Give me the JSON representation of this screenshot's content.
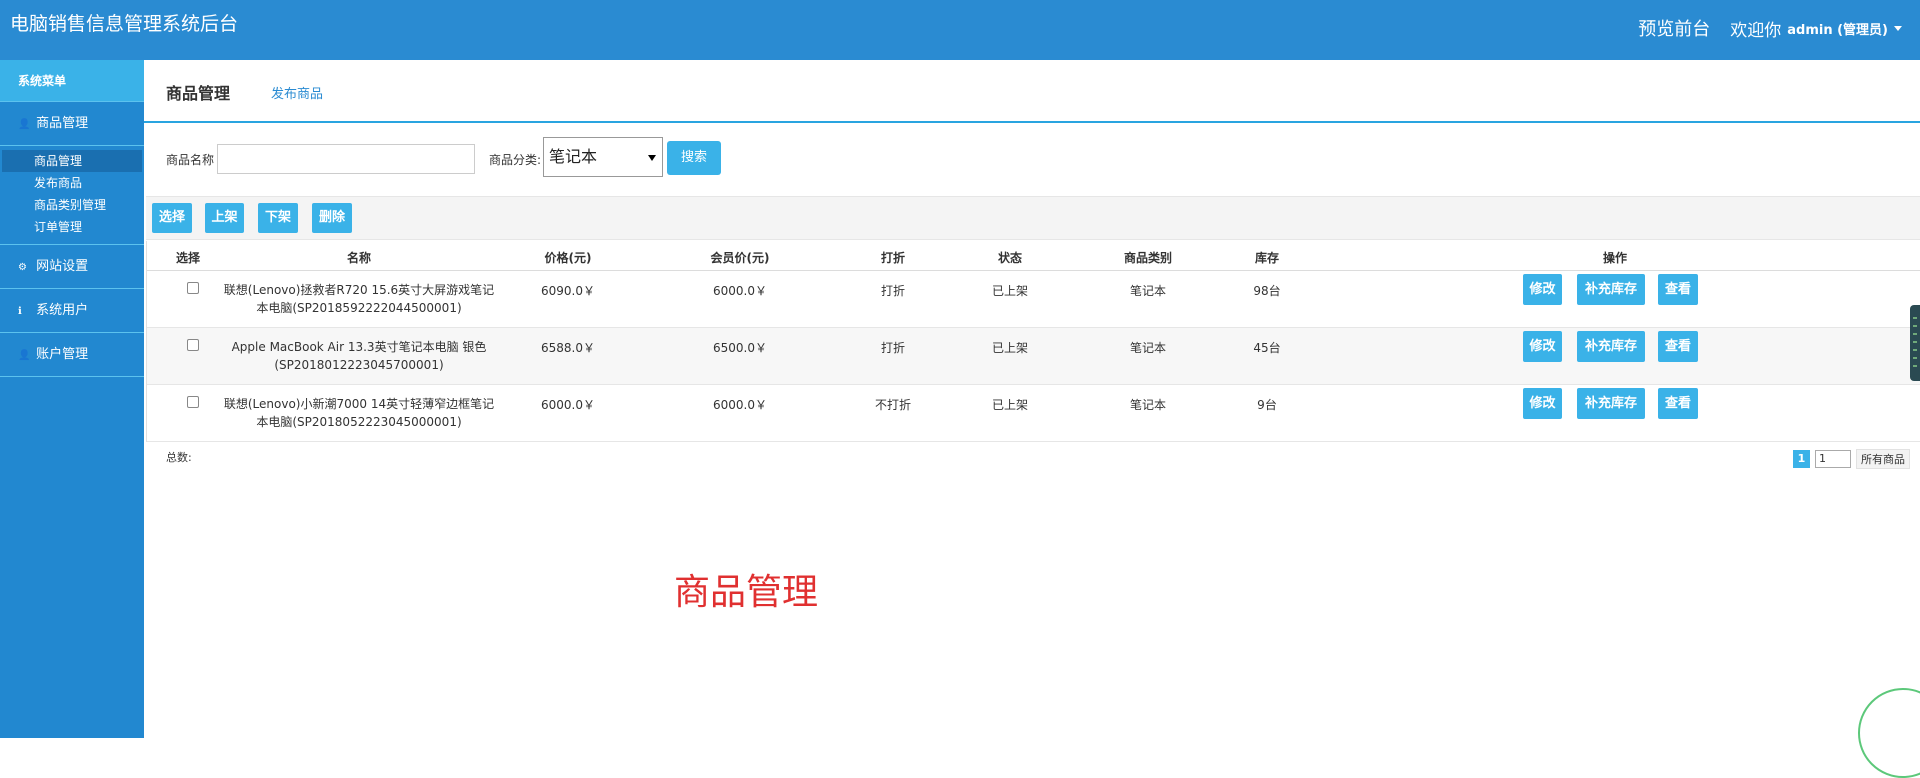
{
  "header": {
    "app_title": "电脑销售信息管理系统后台",
    "preview_label": "预览前台",
    "welcome_label": "欢迎你",
    "admin_name": "admin (管理员)"
  },
  "sidebar": {
    "menu_title": "系统菜单",
    "groups": [
      {
        "label": "商品管理",
        "icon": "user-icon"
      },
      {
        "label": "网站设置",
        "icon": "gear-icon"
      },
      {
        "label": "系统用户",
        "icon": "info-icon"
      },
      {
        "label": "账户管理",
        "icon": "user-icon"
      }
    ],
    "sub_items": [
      "商品管理",
      "发布商品",
      "商品类别管理",
      "订单管理"
    ]
  },
  "tabs": {
    "current": "商品管理",
    "link": "发布商品"
  },
  "search": {
    "name_label": "商品名称",
    "name_value": "",
    "category_label": "商品分类:",
    "category_value": "笔记本",
    "button_label": "搜索"
  },
  "actions": [
    "选择",
    "上架",
    "下架",
    "删除"
  ],
  "table": {
    "columns": [
      "选择",
      "名称",
      "价格(元)",
      "会员价(元)",
      "打折",
      "状态",
      "商品类别",
      "库存",
      "操作"
    ],
    "rows": [
      {
        "name_line1": "联想(Lenovo)拯救者R720 15.6英寸大屏游戏笔记",
        "name_line2": "本电脑(SP2018592222044500001)",
        "price": "6090.0￥",
        "member_price": "6000.0￥",
        "discount": "打折",
        "status": "已上架",
        "category": "笔记本",
        "stock": "98台"
      },
      {
        "name_line1": "Apple MacBook Air 13.3英寸笔记本电脑 银色",
        "name_line2": "(SP2018012223045700001)",
        "price": "6588.0￥",
        "member_price": "6500.0￥",
        "discount": "打折",
        "status": "已上架",
        "category": "笔记本",
        "stock": "45台"
      },
      {
        "name_line1": "联想(Lenovo)小新潮7000 14英寸轻薄窄边框笔记",
        "name_line2": "本电脑(SP2018052223045000001)",
        "price": "6000.0￥",
        "member_price": "6000.0￥",
        "discount": "不打折",
        "status": "已上架",
        "category": "笔记本",
        "stock": "9台"
      }
    ],
    "row_buttons": [
      "修改",
      "补充库存",
      "查看"
    ]
  },
  "footer": {
    "total_label": "总数:",
    "current_page": "1",
    "page_input": "1",
    "all_label": "所有商品"
  },
  "watermark": "商品管理",
  "colors": {
    "header_bg": "#2a8bd2",
    "sidebar_bg": "#2288d0",
    "accent": "#3ab2e8",
    "watermark": "#e03030"
  }
}
